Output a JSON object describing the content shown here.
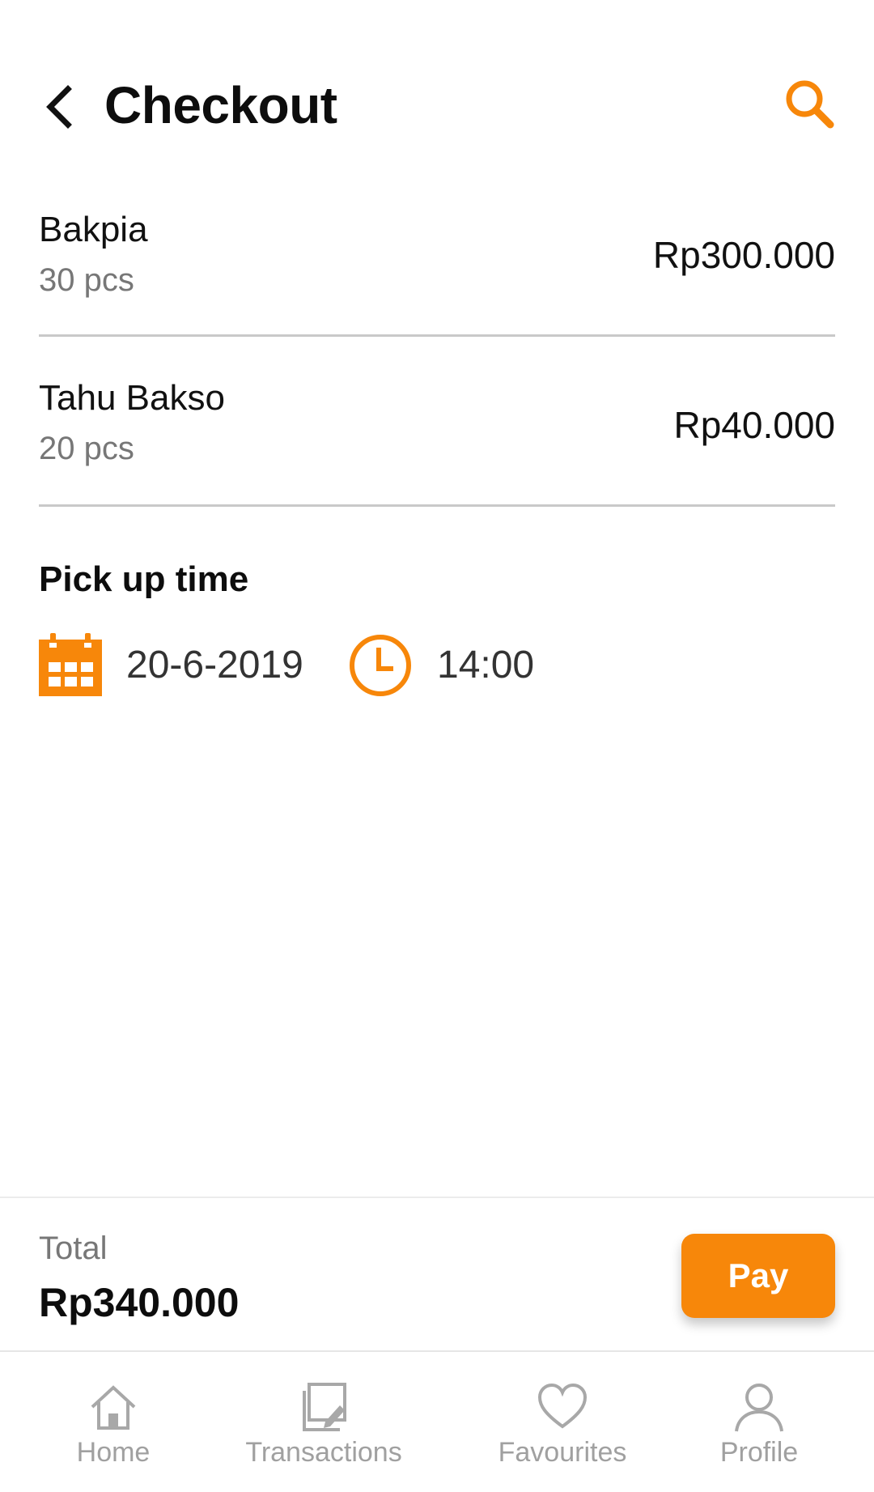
{
  "header": {
    "title": "Checkout",
    "back_icon": "chevron-left-icon",
    "search_icon": "search-icon"
  },
  "items": [
    {
      "name": "Bakpia",
      "qty": "30 pcs",
      "price": "Rp300.000"
    },
    {
      "name": "Tahu Bakso",
      "qty": "20 pcs",
      "price": "Rp40.000"
    }
  ],
  "pickup": {
    "title": "Pick up time",
    "date": "20-6-2019",
    "time": "14:00",
    "date_icon": "calendar-icon",
    "time_icon": "clock-icon"
  },
  "summary": {
    "total_label": "Total",
    "total_value": "Rp340.000",
    "pay_label": "Pay"
  },
  "nav": {
    "items": [
      {
        "label": "Home",
        "icon": "home-icon"
      },
      {
        "label": "Transactions",
        "icon": "transactions-icon"
      },
      {
        "label": "Favourites",
        "icon": "heart-icon"
      },
      {
        "label": "Profile",
        "icon": "profile-icon"
      }
    ]
  },
  "colors": {
    "accent": "#f7870a",
    "muted_text": "#777777",
    "nav_inactive": "#a0a0a0",
    "divider": "#c9c9c9"
  }
}
